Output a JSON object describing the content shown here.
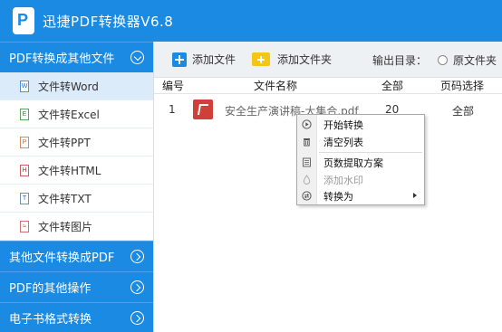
{
  "app": {
    "title": "迅捷PDF转换器V6.8"
  },
  "sidebar": {
    "group1": {
      "label": "PDF转换成其他文件",
      "items": [
        {
          "label": "文件转Word",
          "icon": "word-file-icon",
          "glyph": "W"
        },
        {
          "label": "文件转Excel",
          "icon": "excel-file-icon",
          "glyph": "E"
        },
        {
          "label": "文件转PPT",
          "icon": "ppt-file-icon",
          "glyph": "P"
        },
        {
          "label": "文件转HTML",
          "icon": "html-file-icon",
          "glyph": "H"
        },
        {
          "label": "文件转TXT",
          "icon": "txt-file-icon",
          "glyph": "T"
        },
        {
          "label": "文件转图片",
          "icon": "image-file-icon",
          "glyph": "≈"
        }
      ]
    },
    "group2": {
      "label": "其他文件转换成PDF"
    },
    "group3": {
      "label": "PDF的其他操作"
    },
    "group4": {
      "label": "电子书格式转换"
    }
  },
  "toolbar": {
    "add_file": "添加文件",
    "add_folder": "添加文件夹",
    "output_label": "输出目录：",
    "output_option": "原文件夹"
  },
  "table": {
    "headers": {
      "index": "编号",
      "name": "文件名称",
      "all": "全部",
      "pages": "页码选择"
    },
    "rows": [
      {
        "index": "1",
        "name": "安全生产演讲稿-大集合.pdf",
        "all": "20",
        "pages": "全部"
      }
    ]
  },
  "context_menu": {
    "items": [
      {
        "label": "开始转换",
        "icon": "play-icon"
      },
      {
        "label": "清空列表",
        "icon": "trash-icon"
      },
      {
        "label": "页数提取方案",
        "icon": "document-icon"
      },
      {
        "label": "添加水印",
        "icon": "watermark-icon",
        "disabled": true
      },
      {
        "label": "转换为",
        "icon": "convert-icon",
        "submenu": true
      }
    ]
  },
  "colors": {
    "brand": "#1a8ae2",
    "active_item": "#dcebf9"
  }
}
